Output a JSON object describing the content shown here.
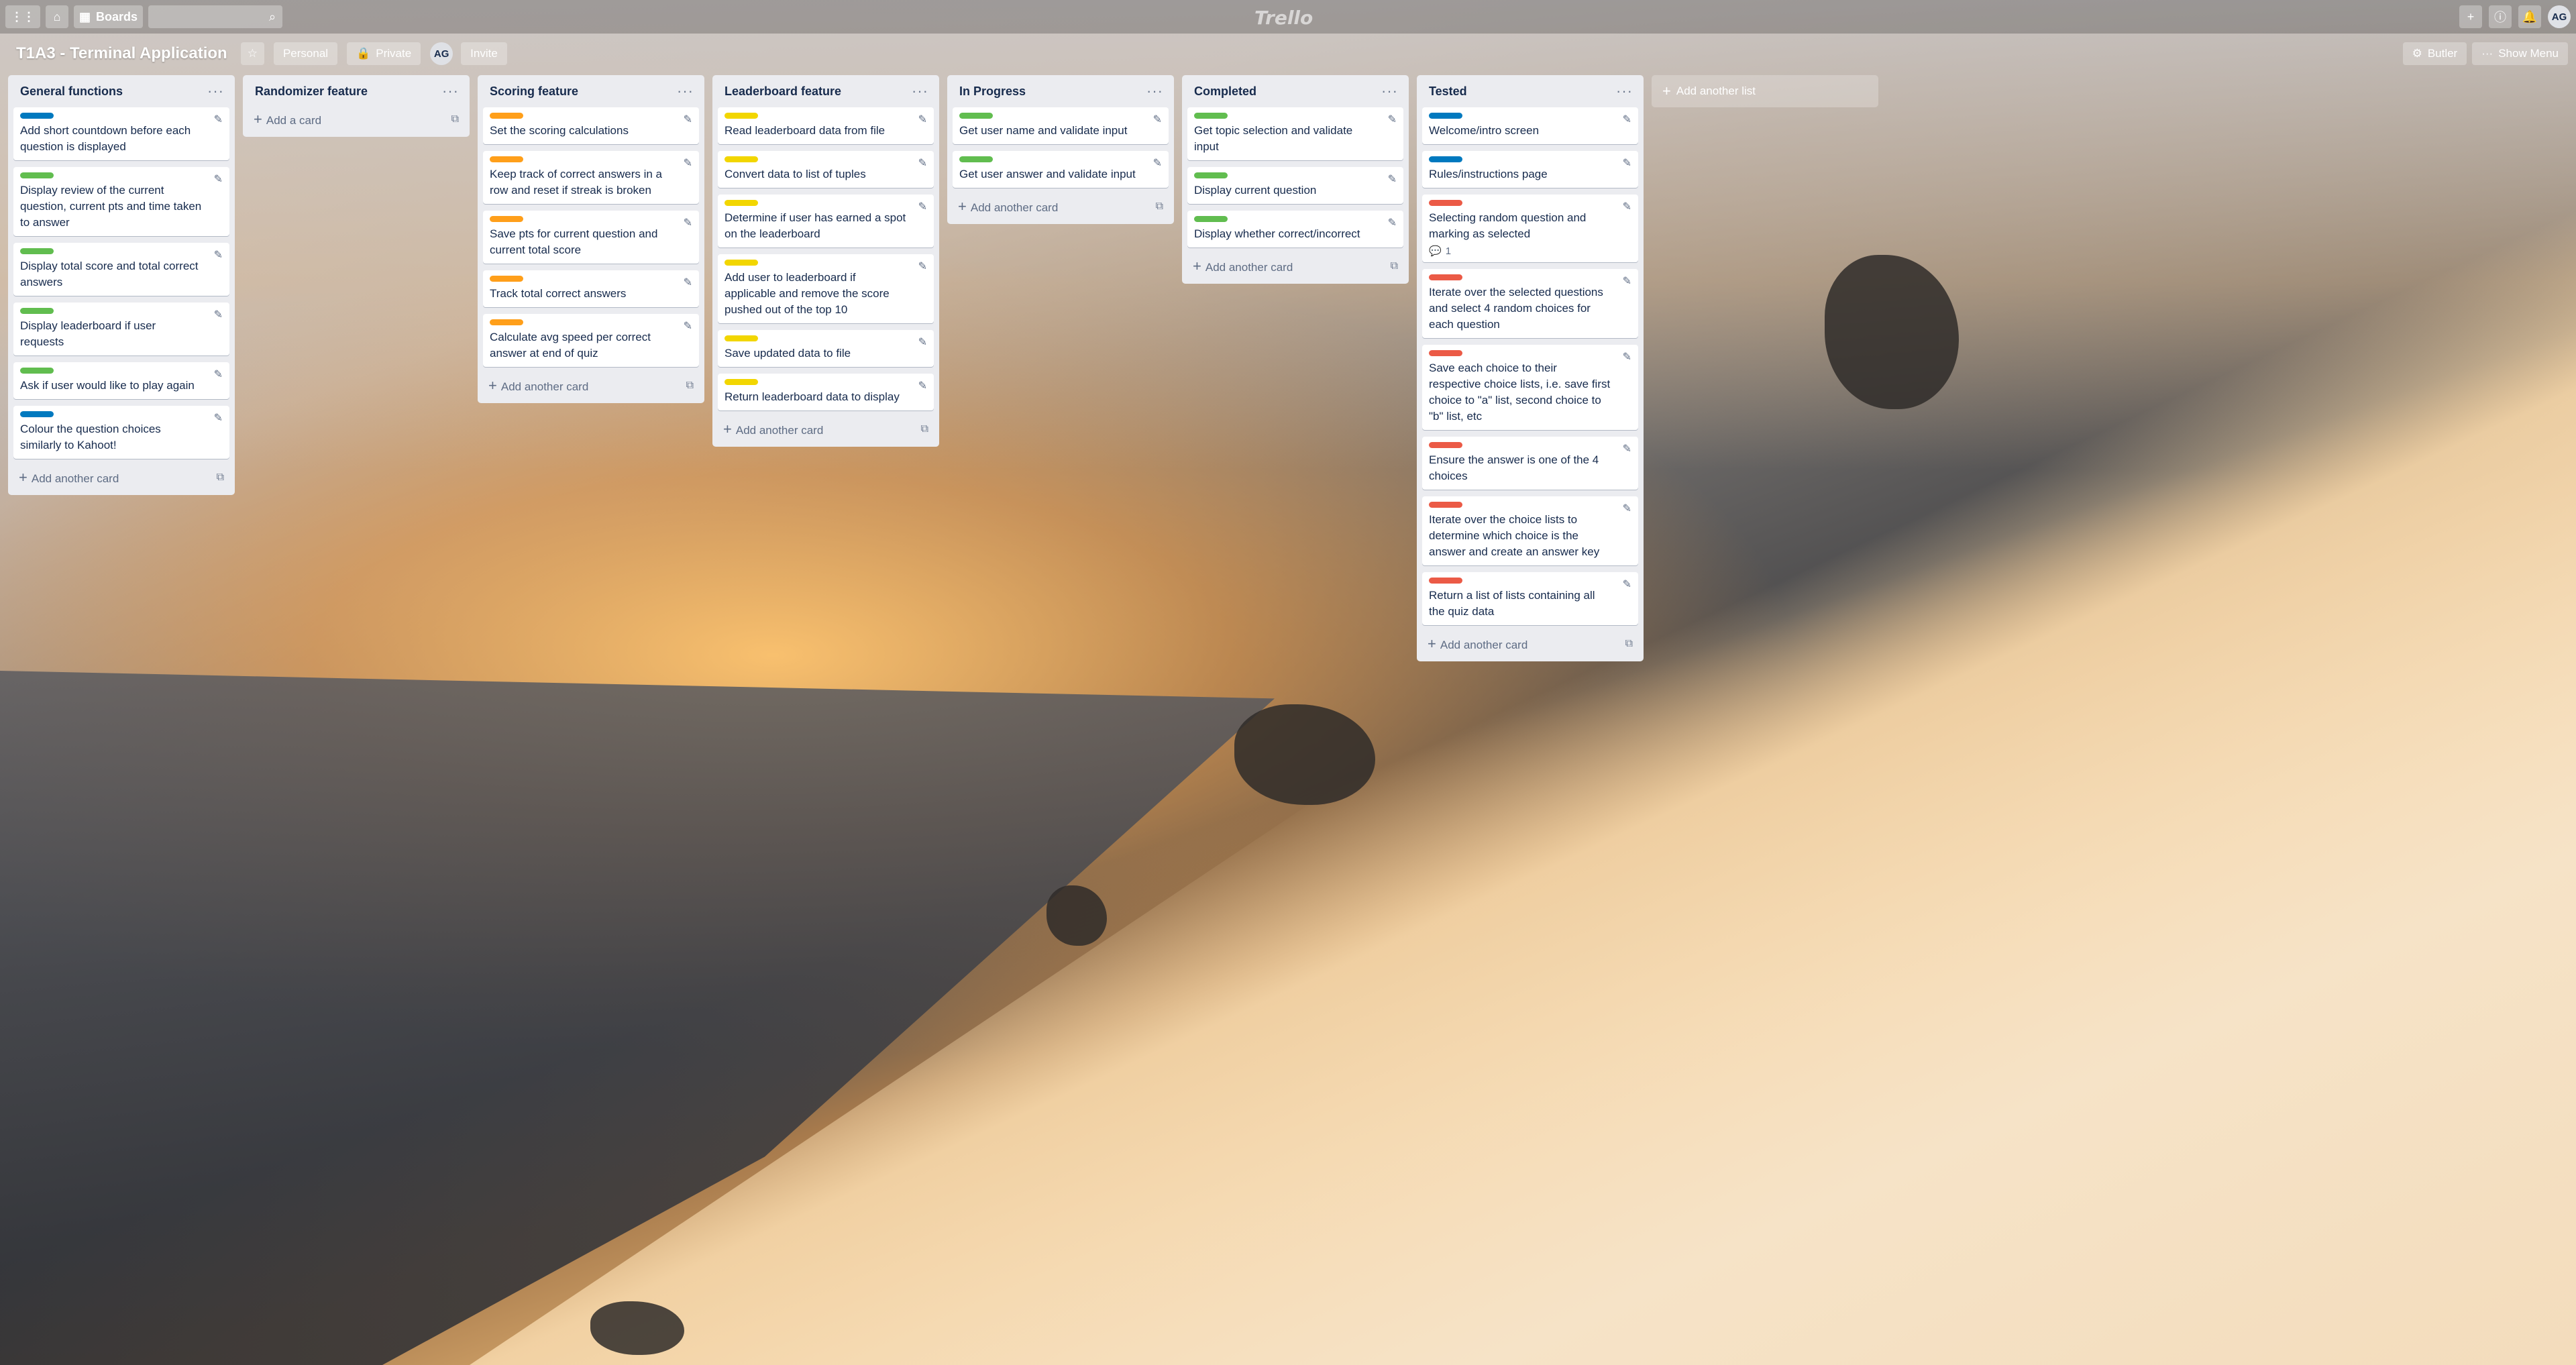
{
  "topbar": {
    "boards_label": "Boards",
    "logo": "Trello",
    "avatar_initials": "AG"
  },
  "board": {
    "title": "T1A3 - Terminal Application",
    "team_label": "Personal",
    "visibility_label": "Private",
    "member_initials": "AG",
    "invite_label": "Invite",
    "butler_label": "Butler",
    "show_menu_label": "Show Menu"
  },
  "lists": [
    {
      "title": "General functions",
      "add_label": "Add another card",
      "cards": [
        {
          "label": "blue",
          "text": "Add short countdown before each question is displayed"
        },
        {
          "label": "green",
          "text": "Display review of the current question, current pts and time taken to answer"
        },
        {
          "label": "green",
          "text": "Display total score and total correct answers"
        },
        {
          "label": "green",
          "text": "Display leaderboard if user requests"
        },
        {
          "label": "green",
          "text": "Ask if user would like to play again"
        },
        {
          "label": "blue",
          "text": "Colour the question choices similarly to Kahoot!"
        }
      ]
    },
    {
      "title": "Randomizer feature",
      "add_label": "Add a card",
      "cards": []
    },
    {
      "title": "Scoring feature",
      "add_label": "Add another card",
      "cards": [
        {
          "label": "orange",
          "text": "Set the scoring calculations"
        },
        {
          "label": "orange",
          "text": "Keep track of correct answers in a row and reset if streak is broken"
        },
        {
          "label": "orange",
          "text": "Save pts for current question and current total score"
        },
        {
          "label": "orange",
          "text": "Track total correct answers"
        },
        {
          "label": "orange",
          "text": "Calculate avg speed per correct answer at end of quiz"
        }
      ]
    },
    {
      "title": "Leaderboard feature",
      "add_label": "Add another card",
      "cards": [
        {
          "label": "yellow",
          "text": "Read leaderboard data from file"
        },
        {
          "label": "yellow",
          "text": "Convert data to list of tuples"
        },
        {
          "label": "yellow",
          "text": "Determine if user has earned a spot on the leaderboard"
        },
        {
          "label": "yellow",
          "text": "Add user to leaderboard if applicable and remove the score pushed out of the top 10"
        },
        {
          "label": "yellow",
          "text": "Save updated data to file"
        },
        {
          "label": "yellow",
          "text": "Return leaderboard data to display"
        }
      ]
    },
    {
      "title": "In Progress",
      "add_label": "Add another card",
      "cards": [
        {
          "label": "green",
          "text": "Get user name and validate input"
        },
        {
          "label": "green",
          "text": "Get user answer and validate input"
        }
      ]
    },
    {
      "title": "Completed",
      "add_label": "Add another card",
      "cards": [
        {
          "label": "green",
          "text": "Get topic selection and validate input"
        },
        {
          "label": "green",
          "text": "Display current question"
        },
        {
          "label": "green",
          "text": "Display whether correct/incorrect"
        }
      ]
    },
    {
      "title": "Tested",
      "add_label": "Add another card",
      "cards": [
        {
          "label": "blue",
          "text": "Welcome/intro screen"
        },
        {
          "label": "blue",
          "text": "Rules/instructions page"
        },
        {
          "label": "red",
          "text": "Selecting random question and marking as selected",
          "comments": "1"
        },
        {
          "label": "red",
          "text": "Iterate over the selected questions and select 4 random choices for each question"
        },
        {
          "label": "red",
          "text": "Save each choice to their respective choice lists, i.e. save first choice to \"a\" list, second choice to \"b\" list, etc"
        },
        {
          "label": "red",
          "text": "Ensure the answer is one of the 4 choices"
        },
        {
          "label": "red",
          "text": "Iterate over the choice lists to determine which choice is the answer and create an answer key"
        },
        {
          "label": "red",
          "text": "Return a list of lists containing all the quiz data"
        }
      ]
    }
  ],
  "add_list_label": "Add another list"
}
